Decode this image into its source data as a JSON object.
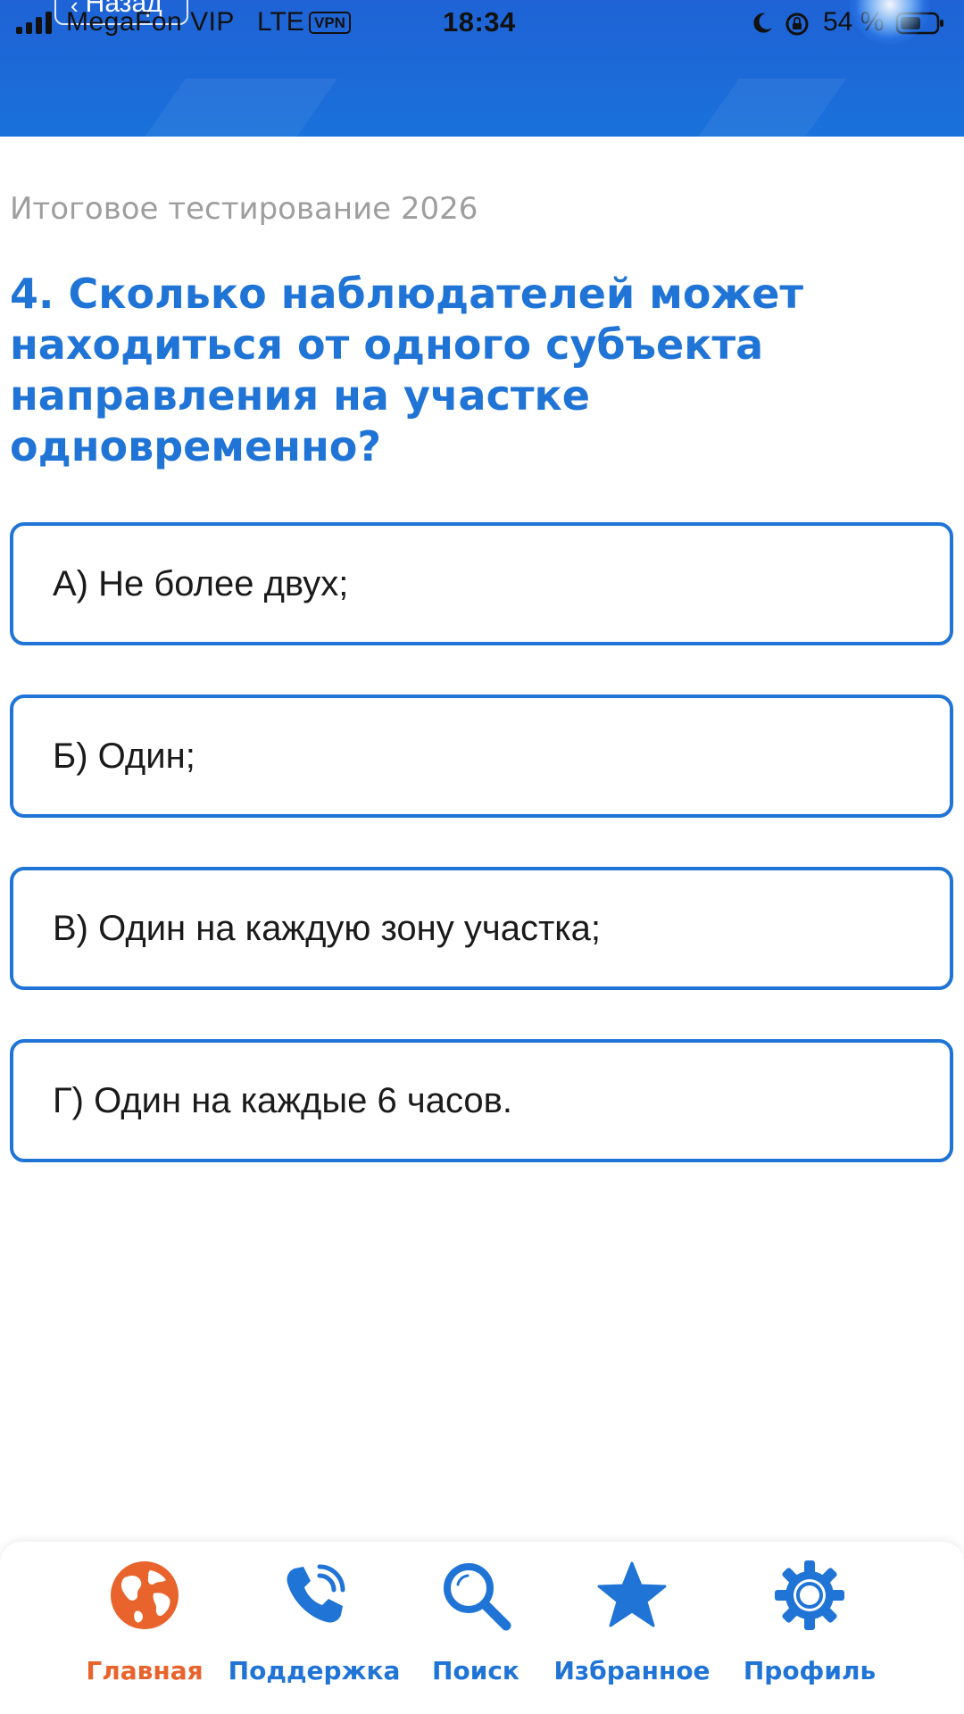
{
  "status_bar": {
    "carrier": "MegaFon VIP",
    "network": "LTE",
    "vpn": "VPN",
    "time": "18:34",
    "battery": "54 %"
  },
  "header": {
    "back_label": "Назад",
    "accent_color": "#1f63d6"
  },
  "quiz": {
    "subtitle": "Итоговое тестирование 2026",
    "question": "4. Сколько наблюдателей может находиться от одного субъекта направления на участке одновременно?",
    "options": [
      {
        "label": "А) Не более двух;"
      },
      {
        "label": "Б) Один;"
      },
      {
        "label": "В) Один на каждую зону участка;"
      },
      {
        "label": "Г) Один на каждые 6 часов."
      }
    ],
    "option_border_color": "#1f74d6"
  },
  "tabbar": {
    "active_color": "#e8642c",
    "inactive_color": "#1f74d6",
    "items": [
      {
        "label": "Главная",
        "icon": "globe-icon",
        "active": true
      },
      {
        "label": "Поддержка",
        "icon": "phone-icon",
        "active": false
      },
      {
        "label": "Поиск",
        "icon": "search-icon",
        "active": false
      },
      {
        "label": "Избранное",
        "icon": "star-icon",
        "active": false
      },
      {
        "label": "Профиль",
        "icon": "gear-icon",
        "active": false
      }
    ]
  }
}
